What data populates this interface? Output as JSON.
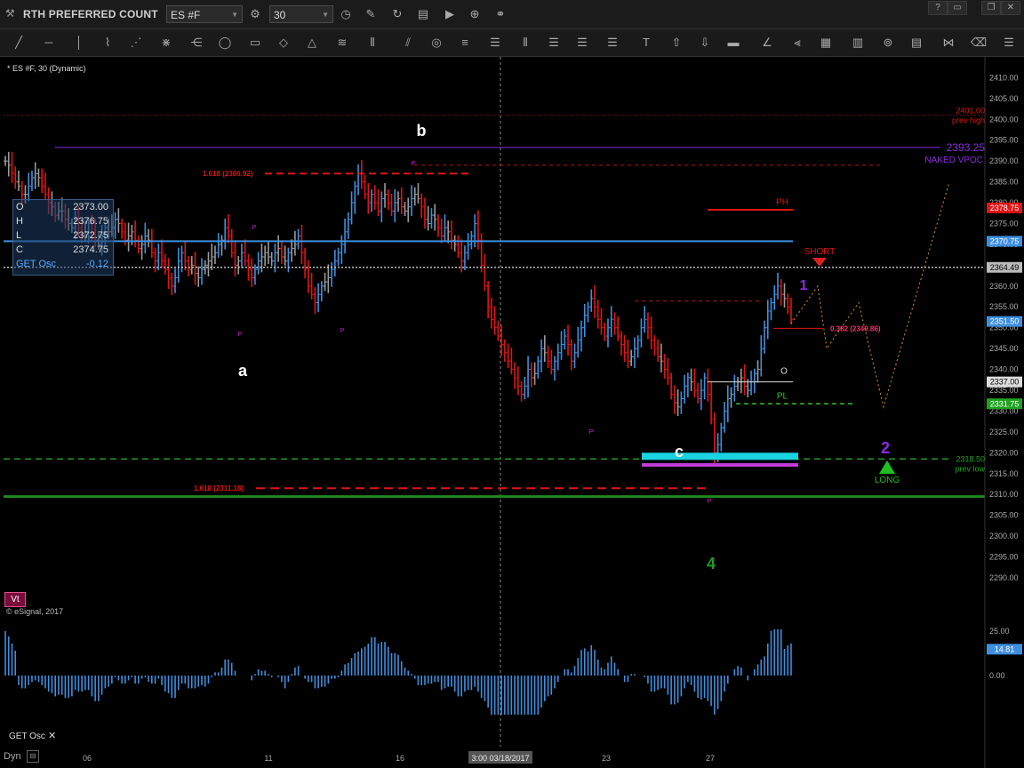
{
  "window": {
    "title": "RTH  PREFERRED COUNT",
    "symbol": "ES #F",
    "interval": "30",
    "buttons": [
      "?",
      "▭",
      "❐",
      "✕"
    ]
  },
  "chart_header": "* ES #F, 30 (Dynamic)",
  "ohlc": [
    {
      "k": "O",
      "v": "2373.00"
    },
    {
      "k": "H",
      "v": "2376.75"
    },
    {
      "k": "L",
      "v": "2372.75"
    },
    {
      "k": "C",
      "v": "2374.75"
    },
    {
      "k": "GET Osc",
      "v": "-0.12"
    }
  ],
  "watermark": "© eSignal, 2017",
  "vt_badge": "Vt",
  "osc_label": "GET Osc",
  "osc_close": "✕",
  "dyn_label": "Dyn",
  "colors": {
    "up": "#3d8fe0",
    "down": "#e01414",
    "neutral": "#9a9a9a",
    "vpoc": "#8a2be2",
    "prev_high": "#e01414",
    "prev_low": "#1fa31f",
    "fib": "#e01414",
    "cursor_line": "#8a8a8a",
    "hline_blue": "#3d8fe0"
  },
  "chart_data": {
    "type": "line",
    "subtype": "candlestick-bar",
    "ylim": [
      2290,
      2412
    ],
    "y_ticks": [
      2290,
      2295,
      2300,
      2305,
      2310,
      2315,
      2320,
      2325,
      2330,
      2335,
      2340,
      2345,
      2350,
      2355,
      2360,
      2365,
      2370,
      2375,
      2380,
      2385,
      2390,
      2395,
      2400,
      2405,
      2410
    ],
    "x_ticks": [
      "06",
      "11",
      "16",
      "23",
      "27"
    ],
    "crosshair_date": "3:00 03/18/2017",
    "price_tags": [
      {
        "label": "2378.75",
        "value": 2378.75,
        "color": "#e01414"
      },
      {
        "label": "2370.75",
        "value": 2370.75,
        "color": "#3d8fe0"
      },
      {
        "label": "2364.49",
        "value": 2364.49,
        "color": "#bbbbbb"
      },
      {
        "label": "2351.50",
        "value": 2351.5,
        "color": "#3d8fe0"
      },
      {
        "label": "2337.00",
        "value": 2337.0,
        "color": "#dddddd"
      },
      {
        "label": "2331.75",
        "value": 2331.75,
        "color": "#1fa31f"
      }
    ],
    "levels": [
      {
        "name": "prev high",
        "value": "2401.00",
        "price": 2401.0
      },
      {
        "name": "NAKED VPOC",
        "value": "2393.25",
        "price": 2393.25
      },
      {
        "name": "prev low",
        "value": "2318.50",
        "price": 2318.5
      }
    ],
    "fib_labels": [
      "1.618 (2386.92)",
      "1.618 (2311.18)",
      "0.382 (2349.86)"
    ],
    "wave_labels": [
      "a",
      "b",
      "c",
      "1",
      "2",
      "4"
    ],
    "annotations": [
      "SHORT",
      "LONG",
      "PH",
      "PL",
      "O"
    ],
    "oscillator": {
      "name": "GET Osc",
      "ylim": [
        -20,
        30
      ],
      "y_ticks": [
        "25.00",
        "0.00"
      ],
      "last_value": "14.81"
    },
    "price_path": [
      2390,
      2389,
      2387,
      2385,
      2384,
      2382,
      2382,
      2384,
      2386,
      2387,
      2386,
      2384,
      2382,
      2380,
      2379,
      2377,
      2378,
      2378,
      2376,
      2375,
      2374,
      2376,
      2374,
      2372,
      2373,
      2375,
      2373,
      2371,
      2370,
      2372,
      2374,
      2373,
      2374,
      2376,
      2375,
      2373,
      2371,
      2372,
      2373,
      2371,
      2369,
      2370,
      2372,
      2371,
      2368,
      2366,
      2368,
      2366,
      2364,
      2362,
      2360,
      2362,
      2366,
      2368,
      2366,
      2364,
      2365,
      2363,
      2362,
      2364,
      2365,
      2366,
      2367,
      2368,
      2370,
      2371,
      2374,
      2372,
      2368,
      2365,
      2366,
      2368,
      2366,
      2364,
      2362,
      2364,
      2366,
      2367,
      2368,
      2367,
      2366,
      2368,
      2369,
      2367,
      2366,
      2368,
      2369,
      2370,
      2372,
      2368,
      2364,
      2360,
      2358,
      2356,
      2358,
      2360,
      2361,
      2362,
      2364,
      2366,
      2368,
      2370,
      2373,
      2376,
      2380,
      2384,
      2387,
      2385,
      2382,
      2380,
      2382,
      2380,
      2378,
      2381,
      2382,
      2380,
      2378,
      2380,
      2381,
      2379,
      2378,
      2379,
      2381,
      2382,
      2381,
      2379,
      2376,
      2375,
      2377,
      2376,
      2374,
      2372,
      2374,
      2373,
      2371,
      2370,
      2368,
      2366,
      2368,
      2370,
      2372,
      2375,
      2371,
      2365,
      2360,
      2355,
      2352,
      2350,
      2348,
      2346,
      2344,
      2342,
      2340,
      2338,
      2336,
      2334,
      2336,
      2340,
      2338,
      2339,
      2342,
      2345,
      2344,
      2342,
      2340,
      2342,
      2344,
      2346,
      2348,
      2346,
      2342,
      2344,
      2347,
      2350,
      2353,
      2355,
      2357,
      2355,
      2352,
      2350,
      2348,
      2350,
      2352,
      2350,
      2348,
      2346,
      2344,
      2342,
      2343,
      2345,
      2347,
      2350,
      2352,
      2350,
      2347,
      2345,
      2343,
      2342,
      2340,
      2338,
      2334,
      2332,
      2331,
      2333,
      2336,
      2338,
      2337,
      2335,
      2333,
      2335,
      2338,
      2334,
      2328,
      2320,
      2322,
      2326,
      2330,
      2333,
      2334,
      2336,
      2337,
      2338,
      2336,
      2335,
      2337,
      2339,
      2340,
      2345,
      2350,
      2354,
      2356,
      2358,
      2360,
      2358,
      2357,
      2355,
      2352
    ]
  }
}
